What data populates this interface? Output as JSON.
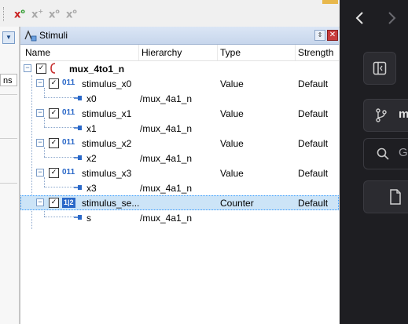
{
  "panel": {
    "title": "Stimuli"
  },
  "left": {
    "ns_label": "ns"
  },
  "columns": {
    "name": "Name",
    "hierarchy": "Hierarchy",
    "type": "Type",
    "strength": "Strength"
  },
  "rows": [
    {
      "name": "mux_4to1_n",
      "hierarchy": "",
      "type": "",
      "strength": ""
    },
    {
      "name": "stimulus_x0",
      "hierarchy": "",
      "type": "Value",
      "strength": "Default",
      "icon": "011"
    },
    {
      "name": "x0",
      "hierarchy": "/mux_4a1_n",
      "type": "",
      "strength": ""
    },
    {
      "name": "stimulus_x1",
      "hierarchy": "",
      "type": "Value",
      "strength": "Default",
      "icon": "011"
    },
    {
      "name": "x1",
      "hierarchy": "/mux_4a1_n",
      "type": "",
      "strength": ""
    },
    {
      "name": "stimulus_x2",
      "hierarchy": "",
      "type": "Value",
      "strength": "Default",
      "icon": "011"
    },
    {
      "name": "x2",
      "hierarchy": "/mux_4a1_n",
      "type": "",
      "strength": ""
    },
    {
      "name": "stimulus_x3",
      "hierarchy": "",
      "type": "Value",
      "strength": "Default",
      "icon": "011"
    },
    {
      "name": "x3",
      "hierarchy": "/mux_4a1_n",
      "type": "",
      "strength": ""
    },
    {
      "name": "stimulus_se...",
      "hierarchy": "",
      "type": "Counter",
      "strength": "Default",
      "icon": "1|2"
    },
    {
      "name": "s",
      "hierarchy": "/mux_4a1_n",
      "type": "",
      "strength": ""
    }
  ],
  "right_panel": {
    "search_partial": "G",
    "branch_partial": "m"
  },
  "colors": {
    "selection": "#cce4f7",
    "accent": "#2a68c8",
    "dark_bg": "#1e1e22"
  }
}
